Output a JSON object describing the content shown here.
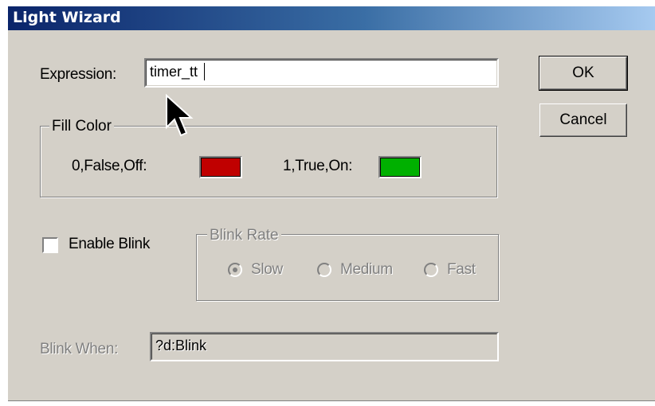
{
  "window": {
    "title": "Light Wizard"
  },
  "expression": {
    "label": "Expression:",
    "value": "timer_tt"
  },
  "buttons": {
    "ok": "OK",
    "cancel": "Cancel"
  },
  "fill_color": {
    "legend": "Fill Color",
    "false_label": "0,False,Off:",
    "false_color": "#c00000",
    "true_label": "1,True,On:",
    "true_color": "#00b000"
  },
  "enable_blink": {
    "label": "Enable Blink",
    "checked": false
  },
  "blink_rate": {
    "legend": "Blink Rate",
    "options": [
      {
        "label": "Slow",
        "selected": true
      },
      {
        "label": "Medium",
        "selected": false
      },
      {
        "label": "Fast",
        "selected": false
      }
    ]
  },
  "blink_when": {
    "label": "Blink When:",
    "value": "?d:Blink"
  },
  "icons": {
    "cursor": "arrow-cursor-icon"
  }
}
